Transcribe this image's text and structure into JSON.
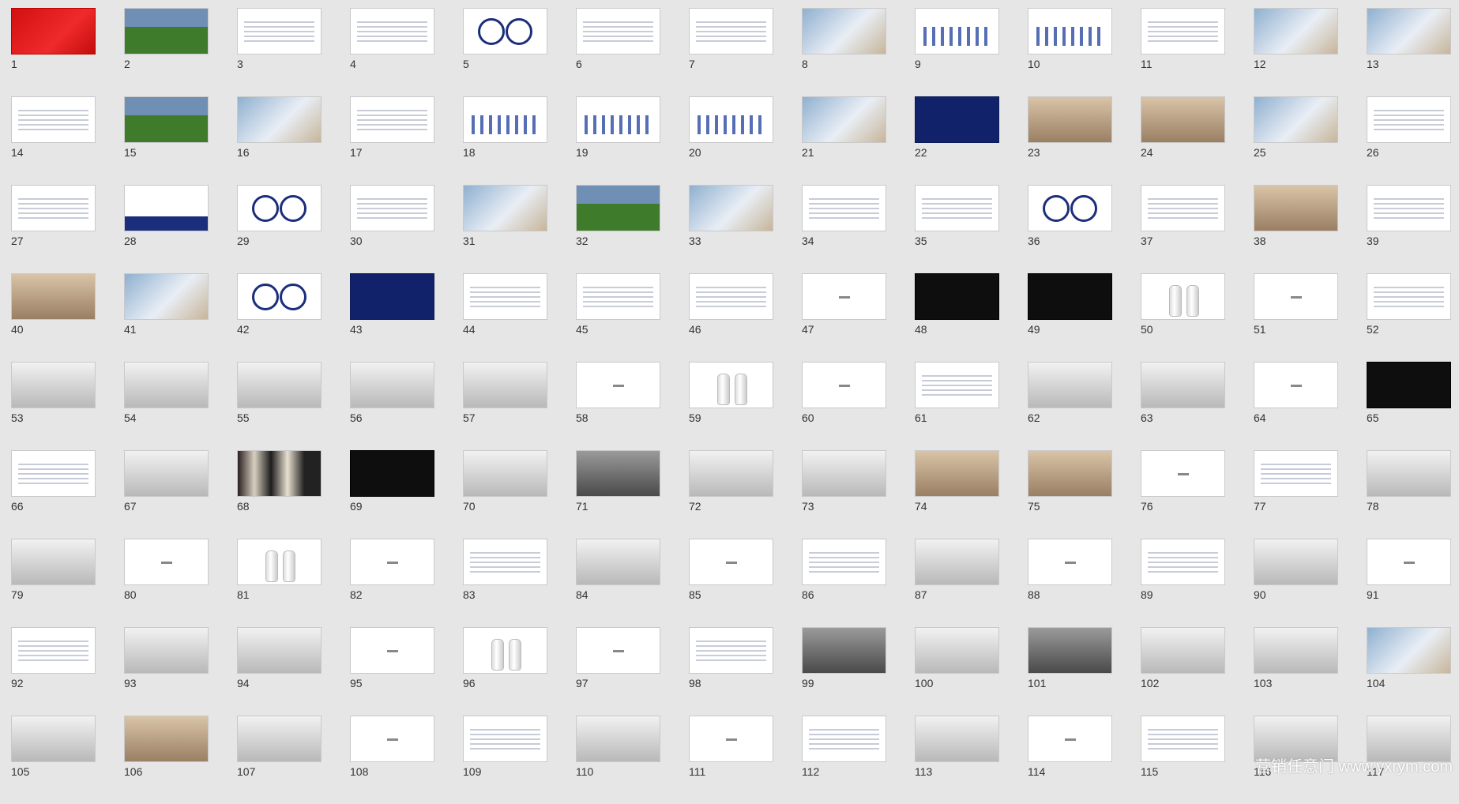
{
  "watermark": "营销任意门 www.yxrym.com",
  "slides": [
    {
      "n": "1",
      "style": "red"
    },
    {
      "n": "2",
      "style": "field"
    },
    {
      "n": "3",
      "style": "slide"
    },
    {
      "n": "4",
      "style": "slide"
    },
    {
      "n": "5",
      "style": "circles"
    },
    {
      "n": "6",
      "style": "slide"
    },
    {
      "n": "7",
      "style": "slide"
    },
    {
      "n": "8",
      "style": "photo"
    },
    {
      "n": "9",
      "style": "chart"
    },
    {
      "n": "10",
      "style": "chart"
    },
    {
      "n": "11",
      "style": "slide"
    },
    {
      "n": "12",
      "style": "photo"
    },
    {
      "n": "13",
      "style": "photo"
    },
    {
      "n": "14",
      "style": "slide"
    },
    {
      "n": "15",
      "style": "field"
    },
    {
      "n": "16",
      "style": "photo"
    },
    {
      "n": "17",
      "style": "slide"
    },
    {
      "n": "18",
      "style": "chart"
    },
    {
      "n": "19",
      "style": "chart"
    },
    {
      "n": "20",
      "style": "chart"
    },
    {
      "n": "21",
      "style": "photo"
    },
    {
      "n": "22",
      "style": "navy"
    },
    {
      "n": "23",
      "style": "store"
    },
    {
      "n": "24",
      "style": "store"
    },
    {
      "n": "25",
      "style": "photo"
    },
    {
      "n": "26",
      "style": "slide"
    },
    {
      "n": "27",
      "style": "slide"
    },
    {
      "n": "28",
      "style": "navybar"
    },
    {
      "n": "29",
      "style": "circles"
    },
    {
      "n": "30",
      "style": "slide"
    },
    {
      "n": "31",
      "style": "photo"
    },
    {
      "n": "32",
      "style": "field"
    },
    {
      "n": "33",
      "style": "photo"
    },
    {
      "n": "34",
      "style": "slide"
    },
    {
      "n": "35",
      "style": "slide"
    },
    {
      "n": "36",
      "style": "circles"
    },
    {
      "n": "37",
      "style": "slide"
    },
    {
      "n": "38",
      "style": "store"
    },
    {
      "n": "39",
      "style": "slide"
    },
    {
      "n": "40",
      "style": "store"
    },
    {
      "n": "41",
      "style": "photo"
    },
    {
      "n": "42",
      "style": "circles"
    },
    {
      "n": "43",
      "style": "navy"
    },
    {
      "n": "44",
      "style": "slide"
    },
    {
      "n": "45",
      "style": "slide"
    },
    {
      "n": "46",
      "style": "slide"
    },
    {
      "n": "47",
      "style": "dot"
    },
    {
      "n": "48",
      "style": "black"
    },
    {
      "n": "49",
      "style": "black"
    },
    {
      "n": "50",
      "style": "bottle"
    },
    {
      "n": "51",
      "style": "dot"
    },
    {
      "n": "52",
      "style": "slide"
    },
    {
      "n": "53",
      "style": "grey"
    },
    {
      "n": "54",
      "style": "grey"
    },
    {
      "n": "55",
      "style": "grey"
    },
    {
      "n": "56",
      "style": "grey"
    },
    {
      "n": "57",
      "style": "grey"
    },
    {
      "n": "58",
      "style": "dot"
    },
    {
      "n": "59",
      "style": "bottle"
    },
    {
      "n": "60",
      "style": "dot"
    },
    {
      "n": "61",
      "style": "slide"
    },
    {
      "n": "62",
      "style": "grey"
    },
    {
      "n": "63",
      "style": "grey"
    },
    {
      "n": "64",
      "style": "dot"
    },
    {
      "n": "65",
      "style": "black"
    },
    {
      "n": "66",
      "style": "slide"
    },
    {
      "n": "67",
      "style": "grey"
    },
    {
      "n": "68",
      "style": "shelf"
    },
    {
      "n": "69",
      "style": "black"
    },
    {
      "n": "70",
      "style": "grey"
    },
    {
      "n": "71",
      "style": "dgrey"
    },
    {
      "n": "72",
      "style": "grey"
    },
    {
      "n": "73",
      "style": "grey"
    },
    {
      "n": "74",
      "style": "store"
    },
    {
      "n": "75",
      "style": "store"
    },
    {
      "n": "76",
      "style": "dot"
    },
    {
      "n": "77",
      "style": "slide"
    },
    {
      "n": "78",
      "style": "grey"
    },
    {
      "n": "79",
      "style": "grey"
    },
    {
      "n": "80",
      "style": "dot"
    },
    {
      "n": "81",
      "style": "bottle"
    },
    {
      "n": "82",
      "style": "dot"
    },
    {
      "n": "83",
      "style": "slide"
    },
    {
      "n": "84",
      "style": "grey"
    },
    {
      "n": "85",
      "style": "dot"
    },
    {
      "n": "86",
      "style": "slide"
    },
    {
      "n": "87",
      "style": "grey"
    },
    {
      "n": "88",
      "style": "dot"
    },
    {
      "n": "89",
      "style": "slide"
    },
    {
      "n": "90",
      "style": "grey"
    },
    {
      "n": "91",
      "style": "dot"
    },
    {
      "n": "92",
      "style": "slide"
    },
    {
      "n": "93",
      "style": "grey"
    },
    {
      "n": "94",
      "style": "grey"
    },
    {
      "n": "95",
      "style": "dot"
    },
    {
      "n": "96",
      "style": "bottle"
    },
    {
      "n": "97",
      "style": "dot"
    },
    {
      "n": "98",
      "style": "slide"
    },
    {
      "n": "99",
      "style": "dgrey"
    },
    {
      "n": "100",
      "style": "grey"
    },
    {
      "n": "101",
      "style": "dgrey"
    },
    {
      "n": "102",
      "style": "grey"
    },
    {
      "n": "103",
      "style": "grey"
    },
    {
      "n": "104",
      "style": "photo"
    },
    {
      "n": "105",
      "style": "grey"
    },
    {
      "n": "106",
      "style": "store"
    },
    {
      "n": "107",
      "style": "grey"
    },
    {
      "n": "108",
      "style": "dot"
    },
    {
      "n": "109",
      "style": "slide"
    },
    {
      "n": "110",
      "style": "grey"
    },
    {
      "n": "111",
      "style": "dot"
    },
    {
      "n": "112",
      "style": "slide"
    },
    {
      "n": "113",
      "style": "grey"
    },
    {
      "n": "114",
      "style": "dot"
    },
    {
      "n": "115",
      "style": "slide"
    },
    {
      "n": "116",
      "style": "grey"
    },
    {
      "n": "117",
      "style": "grey"
    }
  ]
}
